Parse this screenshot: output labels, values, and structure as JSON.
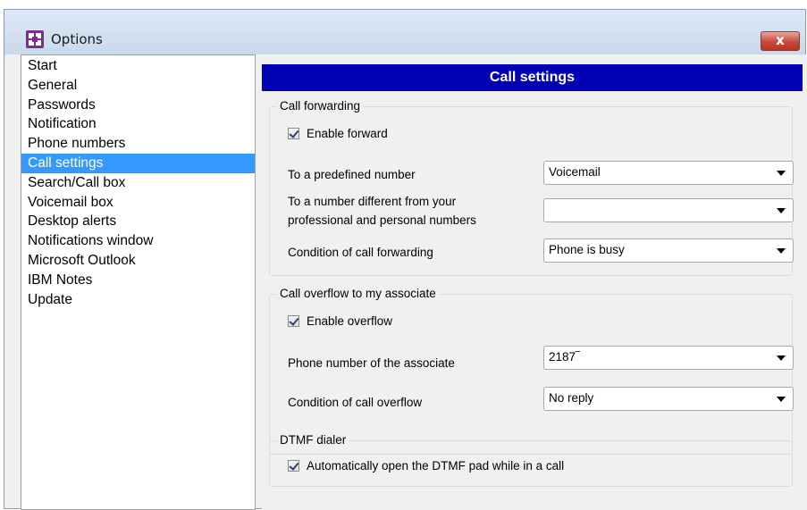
{
  "window": {
    "title": "Options",
    "close_label": "x"
  },
  "nav": {
    "items": [
      "Start",
      "General",
      "Passwords",
      "Notification",
      "Phone numbers",
      "Call settings",
      "Search/Call box",
      "Voicemail box",
      "Desktop alerts",
      "Notifications window",
      "Microsoft Outlook",
      "IBM Notes",
      "Update"
    ],
    "selected": "Call settings"
  },
  "panel": {
    "header": "Call settings",
    "forwarding": {
      "title": "Call forwarding",
      "enable_label": "Enable forward",
      "enable_checked": true,
      "predefined_label": "To a predefined number",
      "predefined_value": "Voicemail",
      "different_label_line1": "To a number different from your",
      "different_label_line2": "professional and personal numbers",
      "different_value": "",
      "condition_label": "Condition of call forwarding",
      "condition_value": "Phone is busy"
    },
    "overflow": {
      "title": "Call overflow to my associate",
      "enable_label": "Enable overflow",
      "enable_checked": true,
      "associate_label": "Phone number of the associate",
      "associate_value": "2187‾",
      "condition_label": "Condition of call overflow",
      "condition_value": "No reply"
    },
    "dtmf": {
      "title": "DTMF dialer",
      "auto_label": "Automatically open the DTMF pad while in a call",
      "auto_checked": true
    }
  },
  "colors": {
    "header_bg": "#0000b5",
    "selected_bg": "#3399ff",
    "close_btn": "#c8493a"
  }
}
